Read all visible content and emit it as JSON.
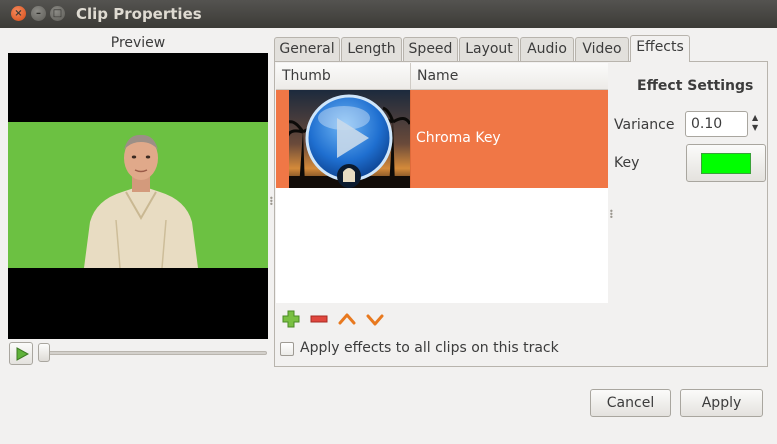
{
  "window": {
    "title": "Clip Properties",
    "close_glyph": "×",
    "min_glyph": "–",
    "max_glyph": "□"
  },
  "preview": {
    "label": "Preview"
  },
  "tabs": [
    {
      "label": "General"
    },
    {
      "label": "Length"
    },
    {
      "label": "Speed"
    },
    {
      "label": "Layout"
    },
    {
      "label": "Audio"
    },
    {
      "label": "Video"
    },
    {
      "label": "Effects",
      "active": true
    }
  ],
  "effects_list": {
    "columns": [
      "Thumb",
      "Name"
    ],
    "rows": [
      {
        "name": "Chroma Key",
        "selected": true
      }
    ]
  },
  "apply_all": {
    "label": "Apply effects to all clips on this track",
    "checked": false
  },
  "effect_settings": {
    "title": "Effect Settings",
    "variance_label": "Variance",
    "variance_value": "0.10",
    "key_label": "Key",
    "key_color": "#00ff00"
  },
  "buttons": {
    "cancel": "Cancel",
    "apply": "Apply"
  },
  "colors": {
    "selection": "#f07746",
    "green_screen": "#6cc142"
  }
}
